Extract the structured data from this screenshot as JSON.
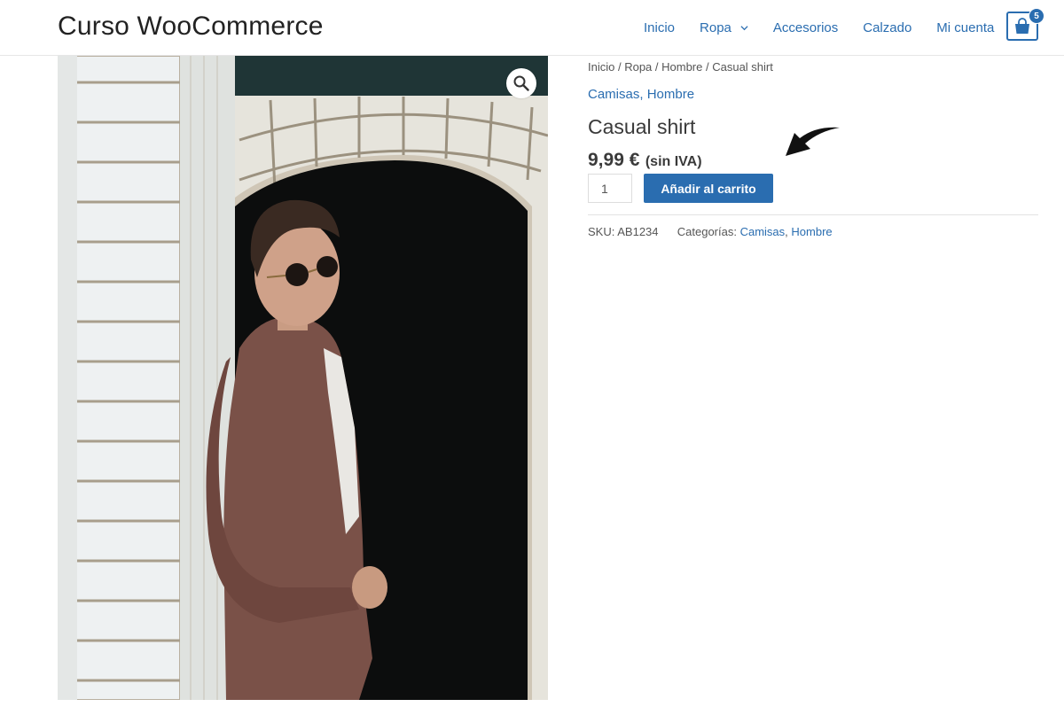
{
  "header": {
    "site_title": "Curso WooCommerce",
    "nav": [
      {
        "label": "Inicio"
      },
      {
        "label": "Ropa",
        "has_dropdown": true
      },
      {
        "label": "Accesorios"
      },
      {
        "label": "Calzado"
      },
      {
        "label": "Mi cuenta"
      }
    ],
    "cart_count": "5",
    "cart_icon": "shopping-bag-icon"
  },
  "product": {
    "image_alt_icon": "zoom-icon",
    "breadcrumb": [
      "Inicio",
      "Ropa",
      "Hombre",
      "Casual shirt"
    ],
    "breadcrumb_sep": " / ",
    "categories_top": [
      "Camisas",
      "Hombre"
    ],
    "title": "Casual shirt",
    "price": "9,99 €",
    "price_suffix": "(sin IVA)",
    "quantity": "1",
    "add_to_cart_label": "Añadir al carrito",
    "meta": {
      "sku_label": "SKU:",
      "sku_value": "AB1234",
      "categories_label": "Categorías:",
      "categories": [
        "Camisas",
        "Hombre"
      ]
    }
  },
  "colors": {
    "accent": "#2a6db0",
    "text": "#3a3a3a"
  }
}
